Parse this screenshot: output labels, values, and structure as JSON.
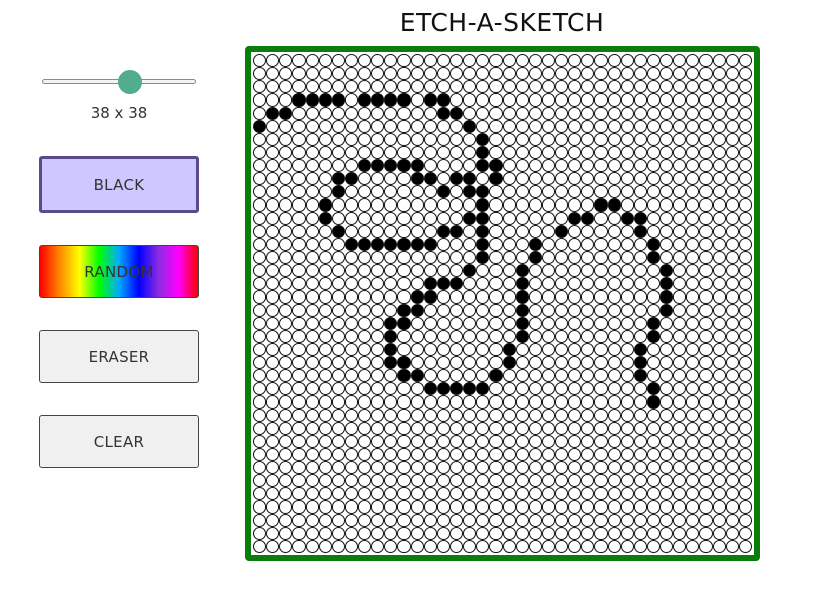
{
  "title": "ETCH-A-SKETCH",
  "slider": {
    "min": 1,
    "max": 64,
    "value": 38
  },
  "size_label": "38 x 38",
  "buttons": {
    "black": "BLACK",
    "random": "RANDOM",
    "eraser": "ERASER",
    "clear": "CLEAR"
  },
  "colors": {
    "board_border": "#0a7d0a",
    "slider_thumb": "#52ac90",
    "active_button": "#cdc8ff"
  },
  "grid": {
    "size": 38,
    "filled_cells": [
      [
        3,
        3
      ],
      [
        3,
        4
      ],
      [
        3,
        5
      ],
      [
        3,
        6
      ],
      [
        3,
        8
      ],
      [
        3,
        9
      ],
      [
        3,
        10
      ],
      [
        3,
        11
      ],
      [
        3,
        13
      ],
      [
        3,
        14
      ],
      [
        4,
        1
      ],
      [
        4,
        2
      ],
      [
        4,
        14
      ],
      [
        4,
        15
      ],
      [
        5,
        0
      ],
      [
        5,
        16
      ],
      [
        6,
        17
      ],
      [
        7,
        17
      ],
      [
        8,
        8
      ],
      [
        8,
        9
      ],
      [
        8,
        10
      ],
      [
        8,
        11
      ],
      [
        8,
        12
      ],
      [
        8,
        17
      ],
      [
        8,
        18
      ],
      [
        9,
        6
      ],
      [
        9,
        7
      ],
      [
        9,
        12
      ],
      [
        9,
        13
      ],
      [
        9,
        15
      ],
      [
        9,
        16
      ],
      [
        9,
        18
      ],
      [
        10,
        6
      ],
      [
        10,
        14
      ],
      [
        10,
        16
      ],
      [
        10,
        17
      ],
      [
        11,
        5
      ],
      [
        11,
        17
      ],
      [
        11,
        26
      ],
      [
        11,
        27
      ],
      [
        12,
        5
      ],
      [
        12,
        16
      ],
      [
        12,
        17
      ],
      [
        12,
        24
      ],
      [
        12,
        25
      ],
      [
        12,
        28
      ],
      [
        12,
        29
      ],
      [
        13,
        6
      ],
      [
        13,
        14
      ],
      [
        13,
        15
      ],
      [
        13,
        17
      ],
      [
        13,
        23
      ],
      [
        13,
        29
      ],
      [
        14,
        7
      ],
      [
        14,
        8
      ],
      [
        14,
        9
      ],
      [
        14,
        10
      ],
      [
        14,
        11
      ],
      [
        14,
        12
      ],
      [
        14,
        13
      ],
      [
        14,
        17
      ],
      [
        14,
        21
      ],
      [
        14,
        30
      ],
      [
        15,
        17
      ],
      [
        15,
        21
      ],
      [
        15,
        30
      ],
      [
        16,
        16
      ],
      [
        16,
        20
      ],
      [
        16,
        31
      ],
      [
        17,
        13
      ],
      [
        17,
        14
      ],
      [
        17,
        15
      ],
      [
        17,
        20
      ],
      [
        17,
        31
      ],
      [
        18,
        12
      ],
      [
        18,
        13
      ],
      [
        18,
        20
      ],
      [
        18,
        31
      ],
      [
        19,
        11
      ],
      [
        19,
        12
      ],
      [
        19,
        20
      ],
      [
        19,
        31
      ],
      [
        20,
        10
      ],
      [
        20,
        11
      ],
      [
        20,
        20
      ],
      [
        20,
        30
      ],
      [
        21,
        10
      ],
      [
        21,
        20
      ],
      [
        21,
        30
      ],
      [
        22,
        10
      ],
      [
        22,
        19
      ],
      [
        22,
        29
      ],
      [
        23,
        10
      ],
      [
        23,
        11
      ],
      [
        23,
        19
      ],
      [
        23,
        29
      ],
      [
        24,
        11
      ],
      [
        24,
        12
      ],
      [
        24,
        18
      ],
      [
        24,
        29
      ],
      [
        25,
        13
      ],
      [
        25,
        14
      ],
      [
        25,
        15
      ],
      [
        25,
        16
      ],
      [
        25,
        17
      ],
      [
        25,
        30
      ],
      [
        26,
        30
      ]
    ]
  }
}
